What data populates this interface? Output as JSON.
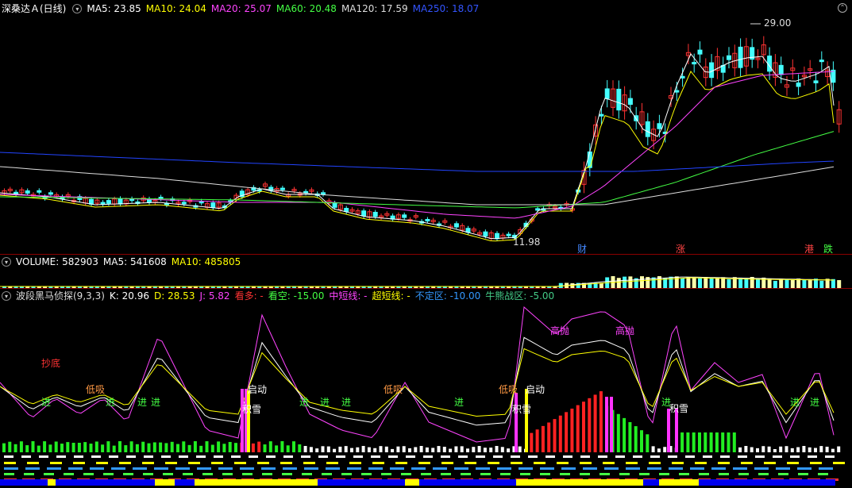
{
  "main": {
    "title": "深桑达Ａ(日线)",
    "ma": [
      {
        "label": "MA5: 23.85",
        "color": "#ffffff"
      },
      {
        "label": "MA10: 24.04",
        "color": "#ffff00"
      },
      {
        "label": "MA20: 25.07",
        "color": "#ff44ff"
      },
      {
        "label": "MA60: 20.48",
        "color": "#44ff44"
      },
      {
        "label": "MA120: 17.59",
        "color": "#dddddd"
      },
      {
        "label": "MA250: 18.07",
        "color": "#3355ff"
      }
    ],
    "high_label": "29.00",
    "low_label": "11.98",
    "markers": [
      {
        "text": "财",
        "color": "#4488ff"
      },
      {
        "text": "涨",
        "color": "#ff4444"
      },
      {
        "text": "港",
        "color": "#ff4444"
      },
      {
        "text": "跌",
        "color": "#44ff44"
      }
    ]
  },
  "volume": {
    "items": [
      {
        "label": "VOLUME: 582903",
        "color": "#ffffff"
      },
      {
        "label": "MA5: 541608",
        "color": "#ffffff"
      },
      {
        "label": "MA10: 485805",
        "color": "#ffff00"
      }
    ]
  },
  "indicator": {
    "items": [
      {
        "label": "波段黑马侦探(9,3,3)",
        "color": "#dddddd"
      },
      {
        "label": "K: 20.96",
        "color": "#ffffff"
      },
      {
        "label": "D: 28.53",
        "color": "#ffff00"
      },
      {
        "label": "J: 5.82",
        "color": "#ff44ff"
      },
      {
        "label": "看多: -",
        "color": "#ff3333"
      },
      {
        "label": "看空: -15.00",
        "color": "#44ff44"
      },
      {
        "label": "中短线: -",
        "color": "#ff44ff"
      },
      {
        "label": "超短线: -",
        "color": "#ffff00"
      },
      {
        "label": "不定区: -10.00",
        "color": "#3399ff"
      },
      {
        "label": "牛熊战区: -5.00",
        "color": "#44cc88"
      }
    ],
    "labels": {
      "chaodi": "抄底",
      "dixi": "低吸",
      "jin": "进",
      "qidong": "启动",
      "jixue": "积雪",
      "gaopao": "高抛"
    }
  }
}
